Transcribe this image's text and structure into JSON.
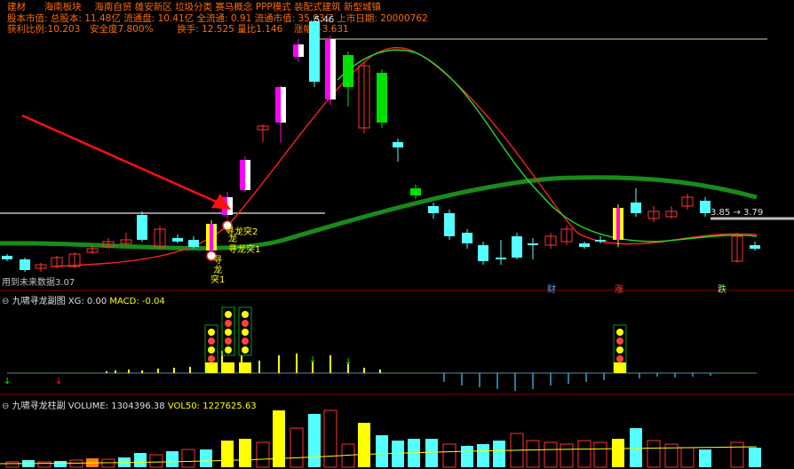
{
  "header": {
    "sector": "建材",
    "line1_items": [
      "海南板块",
      "海南自贸",
      "雄安新区",
      "垃圾分类",
      "赛马概念",
      "PPP模式",
      "装配式建筑",
      "新型城镇"
    ],
    "line2": {
      "stock_value_label": "股本市值:",
      "total_shares_label": "总股本:",
      "total_shares": "11.48亿",
      "float_label": "流通盘:",
      "float_shares": "10.41亿",
      "full_float_label": "全流通:",
      "full_float": "0.91",
      "float_cap_label": "流通市值:",
      "float_cap": "35.93亿",
      "listing_label": "上市日期:",
      "listing_date": "20000762"
    },
    "line3": {
      "profit_ratio_label": "获利比例:",
      "profit_ratio": "10.203",
      "safety_label": "安全度",
      "safety": "7.800%",
      "turnover_label": "换手:",
      "turnover": "12.525",
      "volume_ratio_label": "量比",
      "volume_ratio": "1.146",
      "change_label": "涨幅:",
      "change": "-3.631"
    }
  },
  "main_chart": {
    "high_price_label": "5.46",
    "right_range_label": "3.85 → 3.79",
    "bottom_left_note": "用到未来数据3.07",
    "markers": {
      "xunlong_tu2": "寻龙突2",
      "xunlong_tu1_a": "寻龙突1",
      "xunlong_tu1_b_lines": [
        "寻",
        "龙",
        "突1"
      ],
      "xunlong_tu2_vertical": [
        "寻",
        "龙",
        "突2"
      ]
    },
    "bottom_tags": [
      {
        "text": "财",
        "color": "#5aa0ff"
      },
      {
        "text": "涨",
        "color": "#ff4040"
      },
      {
        "text": "跌",
        "color": "#80ff80"
      }
    ]
  },
  "indicator_panel": {
    "title": "九啸寻龙副图",
    "xg_label": "XG:",
    "xg": "0.00",
    "macd_label": "MACD:",
    "macd": "-0.04"
  },
  "volume_panel": {
    "title": "九啸寻龙柱副",
    "volume_label": "VOLUME:",
    "volume": "1304396.38",
    "vol50_label": "VOL50:",
    "vol50": "1227625.63"
  },
  "colors": {
    "up": "#ff3232",
    "down": "#54ffff",
    "signal_yellow": "#ffff00",
    "signal_magenta": "#ff00ff",
    "ma_green": "#00c000",
    "ma_red": "#ff2020",
    "thick_green": "#1a8a1a"
  }
}
